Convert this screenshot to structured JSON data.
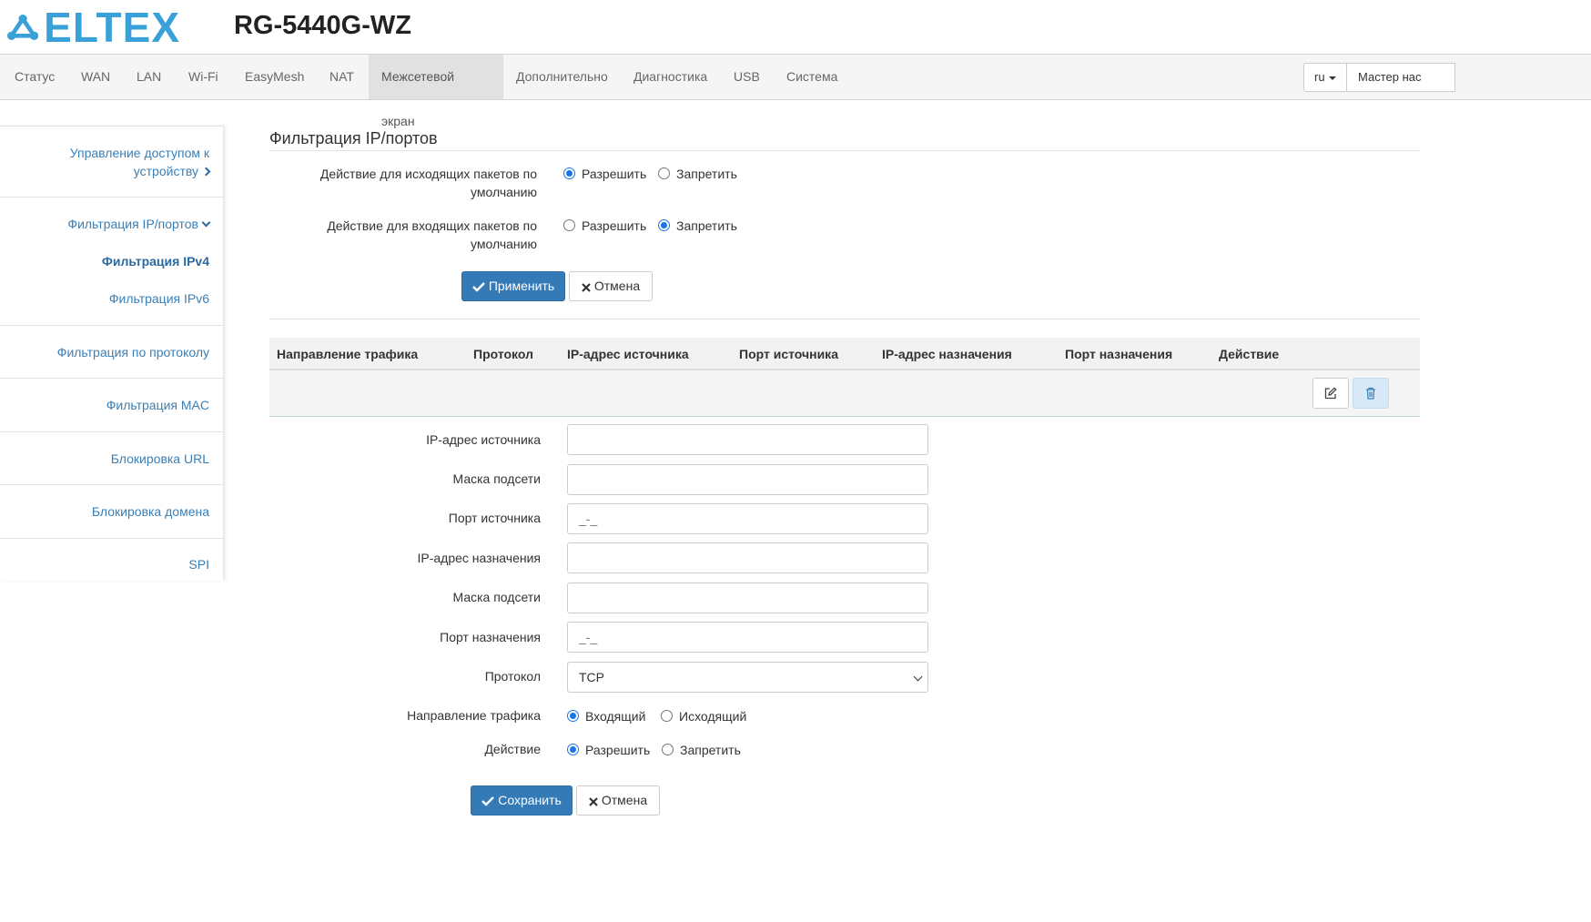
{
  "header": {
    "logo_text": "ELTEX",
    "model": "RG-5440G-WZ"
  },
  "topnav": {
    "items": [
      "Статус",
      "WAN",
      "LAN",
      "Wi-Fi",
      "EasyMesh",
      "NAT",
      "Межсетевой экран",
      "Дополнительно",
      "Диагностика",
      "USB",
      "Система"
    ],
    "active": "Межсетевой экран",
    "language": "ru",
    "wizard_label": "Мастер нас"
  },
  "sidebar": {
    "items": [
      {
        "label_line1": "Управление доступом к",
        "label_line2": "устройству"
      },
      {
        "label": "Фильтрация IP/портов"
      },
      {
        "label": "Фильтрация IPv4"
      },
      {
        "label": "Фильтрация IPv6"
      },
      {
        "label": "Фильтрация по протоколу"
      },
      {
        "label": "Фильтрация MAC"
      },
      {
        "label": "Блокировка URL"
      },
      {
        "label": "Блокировка домена"
      },
      {
        "label": "SPI"
      }
    ]
  },
  "main": {
    "title": "Фильтрация IP/портов",
    "outgoing_default": {
      "label_line1": "Действие для исходящих пакетов по",
      "label_line2": "умолчанию",
      "selected": "Разрешить"
    },
    "incoming_default": {
      "label_line1": "Действие для входящих пакетов по",
      "label_line2": "умолчанию",
      "selected": "Запретить"
    },
    "allow_label": "Разрешить",
    "deny_label": "Запретить",
    "apply_label": "Применить",
    "cancel_label": "Отмена"
  },
  "table": {
    "columns": [
      "Направление трафика",
      "Протокол",
      "IP-адрес источника",
      "Порт источника",
      "IP-адрес назначения",
      "Порт назначения",
      "Действие"
    ]
  },
  "form": {
    "src_ip_label": "IP-адрес источника",
    "src_mask_label": "Маска подсети",
    "src_port_label": "Порт источника",
    "src_port_placeholder": "_-_",
    "dst_ip_label": "IP-адрес назначения",
    "dst_mask_label": "Маска подсети",
    "dst_port_label": "Порт назначения",
    "dst_port_placeholder": "_-_",
    "protocol_label": "Протокол",
    "protocol_value": "TCP",
    "direction_label": "Направление трафика",
    "direction_in": "Входящий",
    "direction_out": "Исходящий",
    "direction_selected": "Входящий",
    "action_label": "Действие",
    "action_allow": "Разрешить",
    "action_deny": "Запретить",
    "action_selected": "Разрешить",
    "save_label": "Сохранить",
    "cancel_label": "Отмена"
  },
  "colors": {
    "brand": "#3aa0d8",
    "primary_button": "#337ab7",
    "link": "#3a7fb6",
    "radio_checked": "#1a73e8"
  }
}
